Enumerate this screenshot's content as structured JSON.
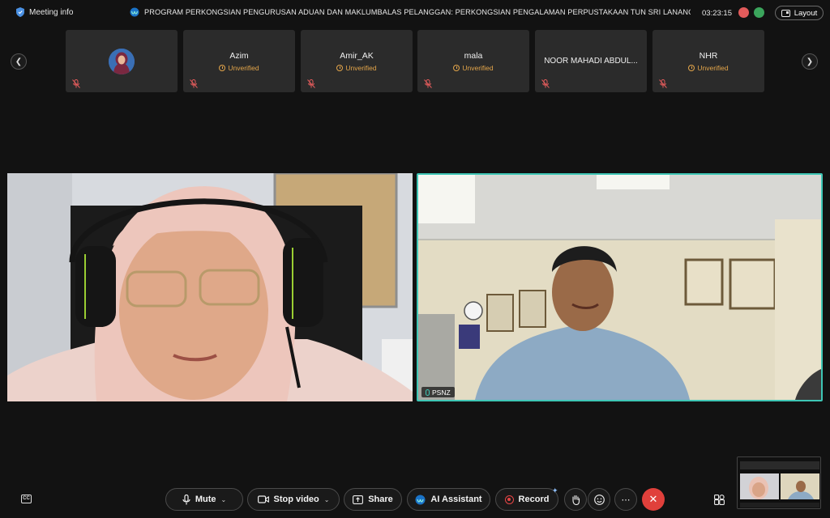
{
  "topbar": {
    "meeting_info_label": "Meeting info",
    "meeting_title": "PROGRAM PERKONGSIAN PENGURUSAN ADUAN DAN MAKLUMBALAS PELANGGAN: PERKONGSIAN PENGALAMAN PERPUSTAKAAN TUN SRI LANANG, UNIVERSITI K",
    "timer": "03:23:15",
    "layout_label": "Layout"
  },
  "participants": [
    {
      "name": "",
      "status": "",
      "has_avatar": true
    },
    {
      "name": "Azim",
      "status": "Unverified"
    },
    {
      "name": "Amir_AK",
      "status": "Unverified"
    },
    {
      "name": "mala",
      "status": "Unverified"
    },
    {
      "name": "NOOR MAHADI ABDUL...",
      "status": ""
    },
    {
      "name": "NHR",
      "status": "Unverified"
    }
  ],
  "videos": {
    "right_name_tag": "PSNZ"
  },
  "controls": {
    "mute": "Mute",
    "stop_video": "Stop video",
    "share": "Share",
    "ai_assistant": "AI Assistant",
    "record": "Record"
  },
  "colors": {
    "accent": "#3ec6b5",
    "unverified": "#e3a54a",
    "end_call": "#e0403b",
    "record": "#e64545"
  }
}
